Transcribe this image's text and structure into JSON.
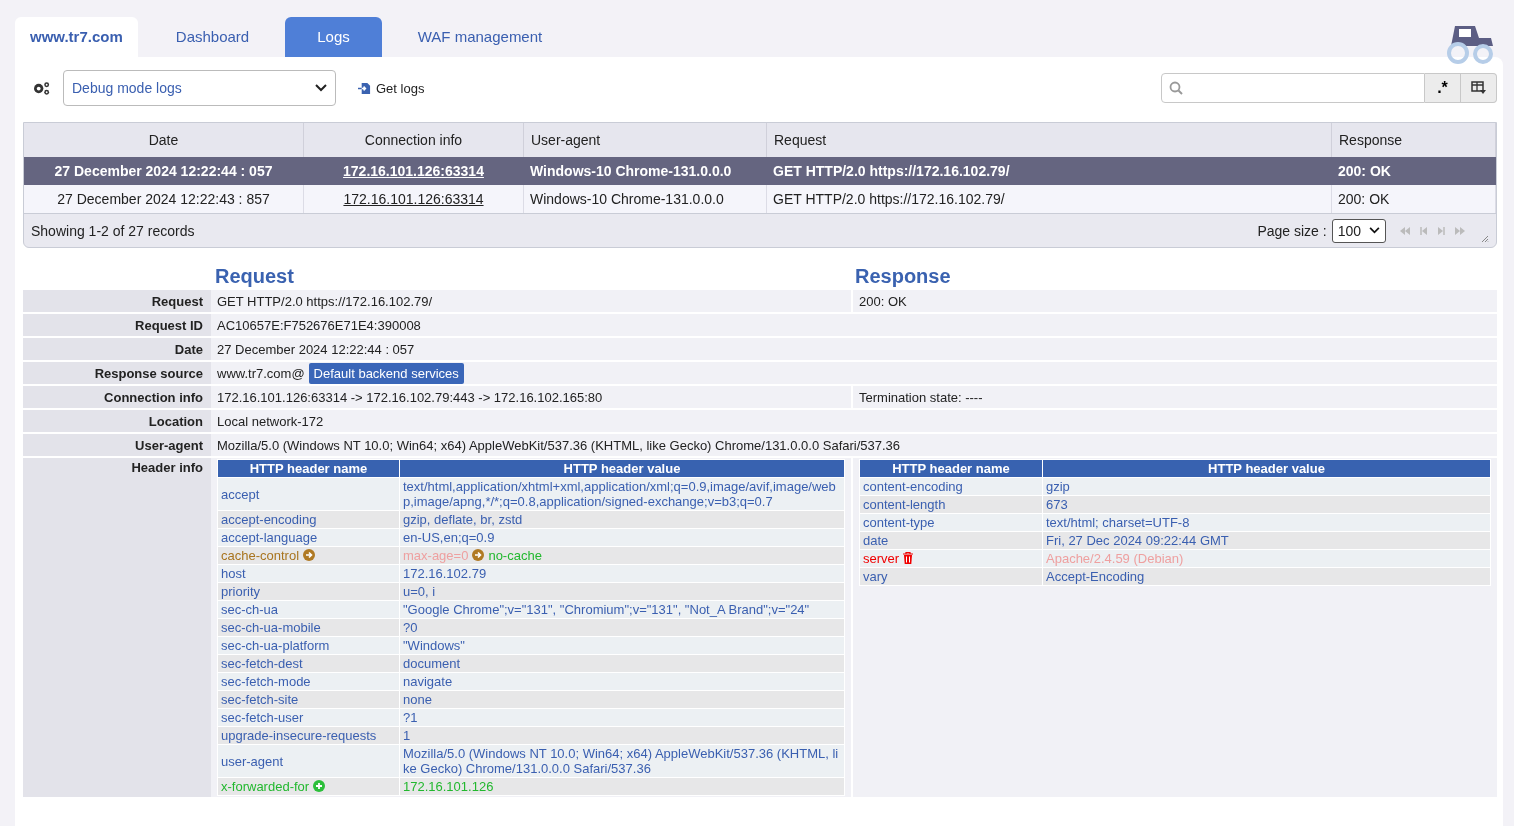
{
  "tabs": [
    {
      "label": "www.tr7.com",
      "kind": "site",
      "selected": false
    },
    {
      "label": "Dashboard",
      "kind": "tab",
      "selected": false
    },
    {
      "label": "Logs",
      "kind": "tab",
      "selected": true
    },
    {
      "label": "WAF management",
      "kind": "tab",
      "selected": false
    }
  ],
  "toolbar": {
    "log_type": "Debug mode logs",
    "get_logs": "Get logs",
    "regex_button": ".*"
  },
  "log_table": {
    "columns": [
      "Date",
      "Connection info",
      "User-agent",
      "Request",
      "Response"
    ],
    "rows": [
      {
        "date": "27 December 2024 12:22:44 : 057",
        "connection": "172.16.101.126:63314",
        "user_agent": "Windows-10 Chrome-131.0.0.0",
        "request": "GET HTTP/2.0 https://172.16.102.79/",
        "response": "200: OK",
        "selected": true
      },
      {
        "date": "27 December 2024 12:22:43 : 857",
        "connection": "172.16.101.126:63314",
        "user_agent": "Windows-10 Chrome-131.0.0.0",
        "request": "GET HTTP/2.0 https://172.16.102.79/",
        "response": "200: OK",
        "selected": false
      }
    ],
    "summary": "Showing 1-2 of 27 records",
    "page_size_label": "Page size :",
    "page_size": "100"
  },
  "details": {
    "request_title": "Request",
    "response_title": "Response",
    "rows": [
      {
        "label": "Request",
        "value": "GET HTTP/2.0 https://172.16.102.79/",
        "response": "200: OK"
      },
      {
        "label": "Request ID",
        "value": "AC10657E:F752676E71E4:390008"
      },
      {
        "label": "Date",
        "value": "27 December 2024 12:22:44 : 057"
      },
      {
        "label": "Response source",
        "value": "www.tr7.com@",
        "badge": "Default backend services"
      },
      {
        "label": "Connection info",
        "value": "172.16.101.126:63314 -> 172.16.102.79:443 -> 172.16.102.165:80",
        "response": "Termination state: ----"
      },
      {
        "label": "Location",
        "value": "Local network-172"
      },
      {
        "label": "User-agent",
        "value": "Mozilla/5.0 (Windows NT 10.0; Win64; x64) AppleWebKit/537.36 (KHTML, like Gecko) Chrome/131.0.0.0 Safari/537.36"
      }
    ],
    "header_label": "Header info",
    "header_columns": [
      "HTTP header name",
      "HTTP header value"
    ],
    "response_header_columns": [
      "HTTP header name",
      "HTTP header value"
    ],
    "request_headers": [
      {
        "name": "accept",
        "value": "text/html,application/xhtml+xml,application/xml;q=0.9,image/avif,image/webp,image/apng,*/*;q=0.8,application/signed-exchange;v=b3;q=0.7",
        "kind": "normal"
      },
      {
        "name": "accept-encoding",
        "value": "gzip, deflate, br, zstd",
        "kind": "normal"
      },
      {
        "name": "accept-language",
        "value": "en-US,en;q=0.9",
        "kind": "normal"
      },
      {
        "name": "cache-control",
        "old_value": "max-age=0",
        "value": "no-cache",
        "kind": "modified"
      },
      {
        "name": "host",
        "value": "172.16.102.79",
        "kind": "normal"
      },
      {
        "name": "priority",
        "value": "u=0, i",
        "kind": "normal"
      },
      {
        "name": "sec-ch-ua",
        "value": "\"Google Chrome\";v=\"131\", \"Chromium\";v=\"131\", \"Not_A Brand\";v=\"24\"",
        "kind": "normal"
      },
      {
        "name": "sec-ch-ua-mobile",
        "value": "?0",
        "kind": "normal"
      },
      {
        "name": "sec-ch-ua-platform",
        "value": "\"Windows\"",
        "kind": "normal"
      },
      {
        "name": "sec-fetch-dest",
        "value": "document",
        "kind": "normal"
      },
      {
        "name": "sec-fetch-mode",
        "value": "navigate",
        "kind": "normal"
      },
      {
        "name": "sec-fetch-site",
        "value": "none",
        "kind": "normal"
      },
      {
        "name": "sec-fetch-user",
        "value": "?1",
        "kind": "normal"
      },
      {
        "name": "upgrade-insecure-requests",
        "value": "1",
        "kind": "normal"
      },
      {
        "name": "user-agent",
        "value": "Mozilla/5.0 (Windows NT 10.0; Win64; x64) AppleWebKit/537.36 (KHTML, like Gecko) Chrome/131.0.0.0 Safari/537.36",
        "kind": "normal"
      },
      {
        "name": "x-forwarded-for",
        "value": "172.16.101.126",
        "kind": "added"
      }
    ],
    "response_headers": [
      {
        "name": "content-encoding",
        "value": "gzip",
        "kind": "normal"
      },
      {
        "name": "content-length",
        "value": "673",
        "kind": "normal"
      },
      {
        "name": "content-type",
        "value": "text/html; charset=UTF-8",
        "kind": "normal"
      },
      {
        "name": "date",
        "value": "Fri, 27 Dec 2024 09:22:44 GMT",
        "kind": "normal"
      },
      {
        "name": "server",
        "value": "Apache/2.4.59 (Debian)",
        "kind": "removed"
      },
      {
        "name": "vary",
        "value": "Accept-Encoding",
        "kind": "normal"
      }
    ]
  }
}
